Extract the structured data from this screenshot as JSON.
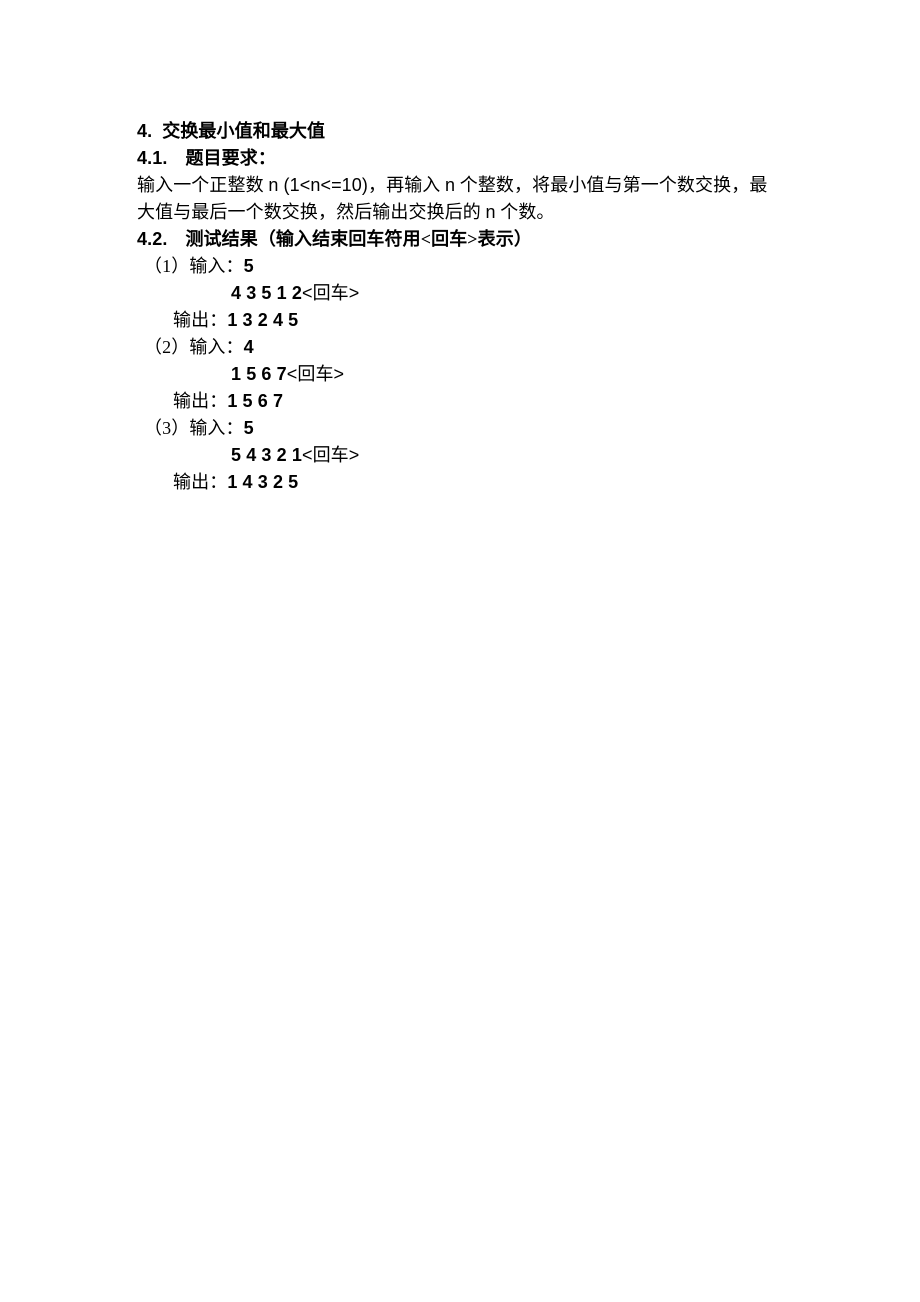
{
  "section": {
    "number": "4.",
    "title": "交换最小值和最大值"
  },
  "sub1": {
    "number": "4.1.",
    "title": "题目要求："
  },
  "description": {
    "pre": "输入一个正整数 ",
    "var": "n (1<n<=10)",
    "mid": "，再输入 ",
    "var2": "n",
    "mid2": " 个整数，将最小值与第一个数交换，最",
    "line2a": "大值与最后一个数交换，然后输出交换后的 ",
    "line2var": "n",
    "line2b": " 个数。"
  },
  "sub2": {
    "number": "4.2.",
    "title": "测试结果（输入结束回车符用<回车>表示）"
  },
  "cases": [
    {
      "idx": "（1）",
      "input_label": "输入：",
      "input_val1": "5",
      "input_val2": "4 3 5 1 2",
      "enter": "<回车>",
      "output_label": "输出：",
      "output_val": "1 3 2 4 5"
    },
    {
      "idx": "（2）",
      "input_label": "输入：",
      "input_val1": "4",
      "input_val2": "1 5 6 7",
      "enter": "<回车>",
      "output_label": "输出：",
      "output_val": "1 5 6 7"
    },
    {
      "idx": "（3）",
      "input_label": "输入：",
      "input_val1": "5",
      "input_val2": "5 4 3 2 1",
      "enter": "<回车>",
      "output_label": "输出：",
      "output_val": "1 4 3 2 5"
    }
  ]
}
